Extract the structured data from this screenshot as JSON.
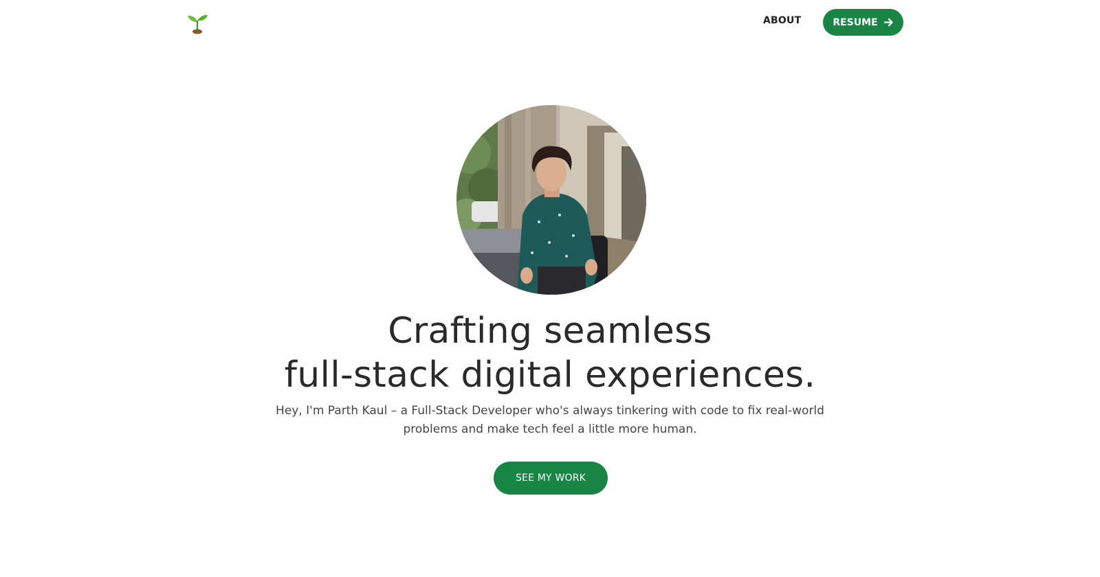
{
  "nav": {
    "about_label": "ABOUT",
    "resume_label": "RESUME"
  },
  "hero": {
    "title_line1": "Crafting seamless",
    "title_line2": "full-stack digital experiences.",
    "description": "Hey, I'm Parth Kaul – a Full-Stack Developer who's always tinkering with code to fix real-world problems and make tech feel a little more human.",
    "cta_label": "SEE MY WORK"
  },
  "icons": {
    "logo": "seedling-icon",
    "resume_arrow": "arrow-right-icon"
  },
  "colors": {
    "accent": "#188544",
    "text": "#2a2a2a",
    "muted": "#444444",
    "background": "#ffffff"
  }
}
